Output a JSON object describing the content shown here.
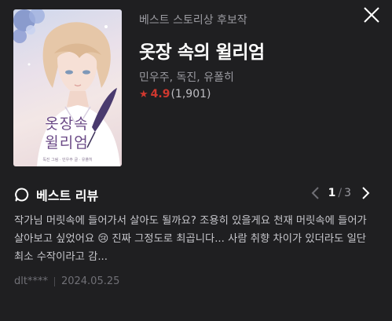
{
  "book": {
    "badge": "베스트 스토리상 후보작",
    "title": "옷장 속의 윌리엄",
    "authors": "민우주, 독진, 유폴히",
    "rating": "4.9",
    "rating_count": "(1,901)",
    "cover": {
      "title_line1": "옷장속",
      "title_line2": "윌리엄",
      "small_text": "독진 그림 · 민우주 글 · 유폴히"
    }
  },
  "review": {
    "heading": "베스트 리뷰",
    "page_current": "1",
    "page_separator": "/",
    "page_total": "3",
    "text": "작가님 머릿속에 들어가서 살아도 될까요? 조용히 있을게요 천재 머릿속에 들어가 살아보고 싶었어요 😢 진짜 그정도로 최곱니다... 사람 취향 차이가 있더라도 일단 최소 수작이라고 감...",
    "author": "dlt****",
    "date": "2024.05.25"
  },
  "icons": {
    "close": "close-icon",
    "star": "star-icon",
    "review": "chat-bubble-icon",
    "prev": "chevron-left-icon",
    "next": "chevron-right-icon"
  },
  "colors": {
    "background": "#1f1f21",
    "accent_red": "#d0382f",
    "muted_text": "#9a9aa0"
  }
}
